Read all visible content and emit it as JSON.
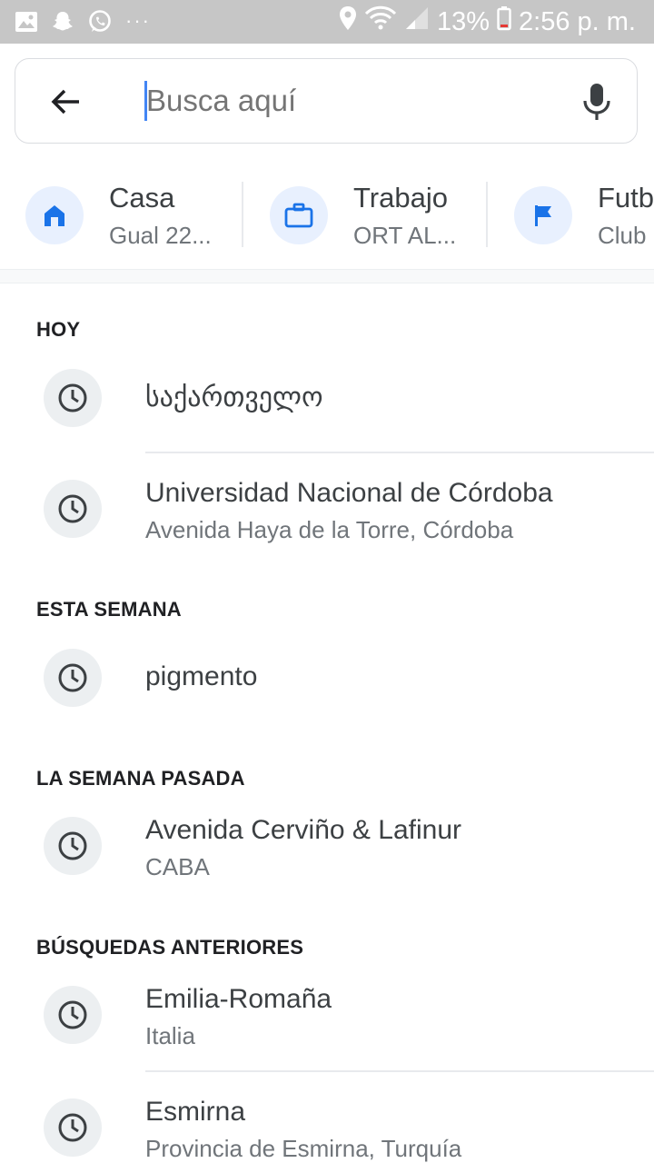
{
  "status_bar": {
    "notification_icons": [
      "image-icon",
      "snapchat-icon",
      "whatsapp-icon"
    ],
    "more": "···",
    "battery": "13%",
    "time": "2:56 p. m."
  },
  "search": {
    "placeholder": "Busca aquí",
    "value": ""
  },
  "shortcuts": [
    {
      "title": "Casa",
      "subtitle": "Gual 22...",
      "icon": "home-icon"
    },
    {
      "title": "Trabajo",
      "subtitle": "ORT AL...",
      "icon": "briefcase-icon"
    },
    {
      "title": "Futb",
      "subtitle": "Club",
      "icon": "flag-icon"
    }
  ],
  "history": {
    "today": {
      "header": "HOY",
      "items": [
        {
          "title": "საქართველო",
          "subtitle": ""
        },
        {
          "title": "Universidad Nacional de Córdoba",
          "subtitle": "Avenida Haya de la Torre, Córdoba"
        }
      ]
    },
    "this_week": {
      "header": "ESTA SEMANA",
      "items": [
        {
          "title": "pigmento",
          "subtitle": ""
        }
      ]
    },
    "last_week": {
      "header": "LA SEMANA PASADA",
      "items": [
        {
          "title": "Avenida Cerviño & Lafinur",
          "subtitle": "CABA"
        }
      ]
    },
    "earlier": {
      "header": "BÚSQUEDAS ANTERIORES",
      "items": [
        {
          "title": "Emilia-Romaña",
          "subtitle": "Italia"
        },
        {
          "title": "Esmirna",
          "subtitle": "Provincia de Esmirna, Turquía"
        }
      ]
    }
  },
  "colors": {
    "accent": "#1a73e8",
    "status_bar": "#c6c6c6",
    "chip_bg": "#e8f0fe",
    "clock_bg": "#eceff1"
  }
}
